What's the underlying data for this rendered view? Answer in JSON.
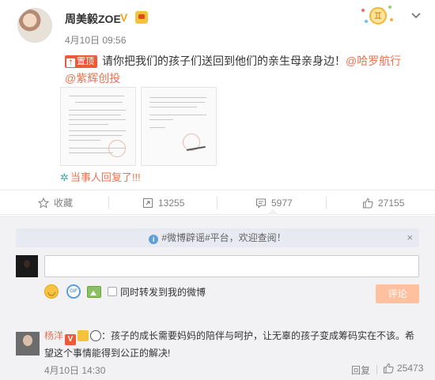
{
  "post": {
    "username": "周美毅ZOE",
    "verified_mark": "V",
    "time": "4月10日 09:56",
    "zodiac_symbol": "♊",
    "pin_label": "置顶",
    "text": "请你把我们的孩子们送回到他们的亲生母亲身边！",
    "mentions": [
      "@哈罗航行",
      "@紫辉创投"
    ],
    "reply_note": "当事人回复了!!!"
  },
  "actions": {
    "favorite": "收藏",
    "repost": "13255",
    "comment": "5977",
    "like": "27155"
  },
  "comments_area": {
    "notice_text": "#微博辟谣#平台，欢迎查阅！",
    "notice_close": "×",
    "input_value": "",
    "forward_checkbox_label": "同时转发到我的微博",
    "submit_label": "评论"
  },
  "comment": {
    "username": "杨洋",
    "verified_mark": "V",
    "separator": "：",
    "text": "孩子的成长需要妈妈的陪伴与呵护，让无辜的孩子变成筹码实在不该。希望这个事情能得到公正的解决!",
    "time": "4月10日 14:30",
    "reply_label": "回复",
    "likes": "25473"
  },
  "colors": {
    "accent_orange": "#eb7350",
    "pin_red": "#eb5a39",
    "submit_disabled": "#ffc09f",
    "panel_bg": "#f2f2f5"
  },
  "icons": [
    "avatar",
    "verified-badge",
    "member-crown-badge",
    "zodiac-gemini-icon",
    "chevron-down-icon",
    "pin-icon",
    "reply-indicator-icon",
    "star-icon",
    "repost-icon",
    "comment-icon",
    "thumbs-up-icon",
    "info-icon",
    "close-icon",
    "emoji-icon",
    "gif-icon",
    "image-icon",
    "panda-icon"
  ]
}
